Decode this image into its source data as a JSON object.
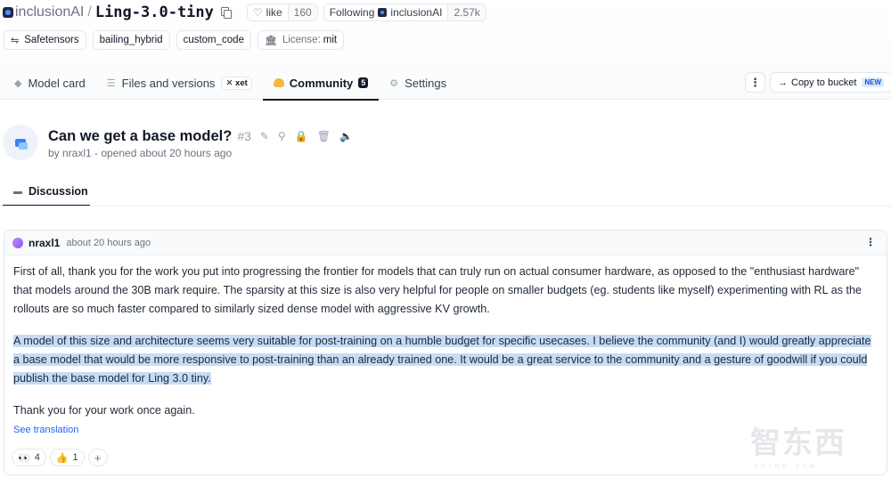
{
  "repo": {
    "org": "inclusionAI",
    "separator": "/",
    "name": "Ling-3.0-tiny",
    "like_label": "like",
    "like_count": "160",
    "following_label": "Following",
    "following_org": "inclusionAI",
    "followers_count": "2.57k"
  },
  "tags": [
    {
      "icon": "safetensors-icon",
      "label": "Safetensors"
    },
    {
      "label": "bailing_hybrid"
    },
    {
      "label": "custom_code"
    },
    {
      "icon": "license-icon",
      "prefix": "License:",
      "label": "mit"
    }
  ],
  "tabs": {
    "model_card": "Model card",
    "files": "Files and versions",
    "xet": "xet",
    "community": "Community",
    "community_count": "5",
    "settings": "Settings"
  },
  "actions": {
    "more": "⋮",
    "copy_bucket": "Copy to bucket",
    "new_badge": "NEW"
  },
  "discussion": {
    "title": "Can we get a base model?",
    "number": "#3",
    "meta": "by nraxl1 - opened about 20 hours ago",
    "tab_label": "Discussion"
  },
  "comment": {
    "author": "nraxl1",
    "time": "about 20 hours ago",
    "para1": "First of all, thank you for the work you put into progressing the frontier for models that can truly run on actual consumer hardware, as opposed to the \"enthusiast hardware\" that models around the 30B mark require. The sparsity at this size is also very helpful for people on smaller budgets (eg. students like myself) experimenting with RL as the rollouts are so much faster compared to similarly sized dense model with aggressive KV growth.",
    "para2": "A model of this size and architecture seems very suitable for post-training on a humble budget for specific usecases. I believe the community (and I) would greatly appreciate a base model that would be more responsive to post-training than an already trained one. It would be a great service to the community and a gesture of goodwill if you could publish the base model for Ling 3.0 tiny.",
    "para3": "Thank you for your work once again.",
    "see_translation": "See translation",
    "reactions": [
      {
        "emoji": "👀",
        "count": "4"
      },
      {
        "emoji": "👍",
        "count": "1"
      }
    ],
    "add_reaction": "+"
  },
  "watermark": {
    "text": "智东西",
    "sub": "zhidx.com"
  }
}
